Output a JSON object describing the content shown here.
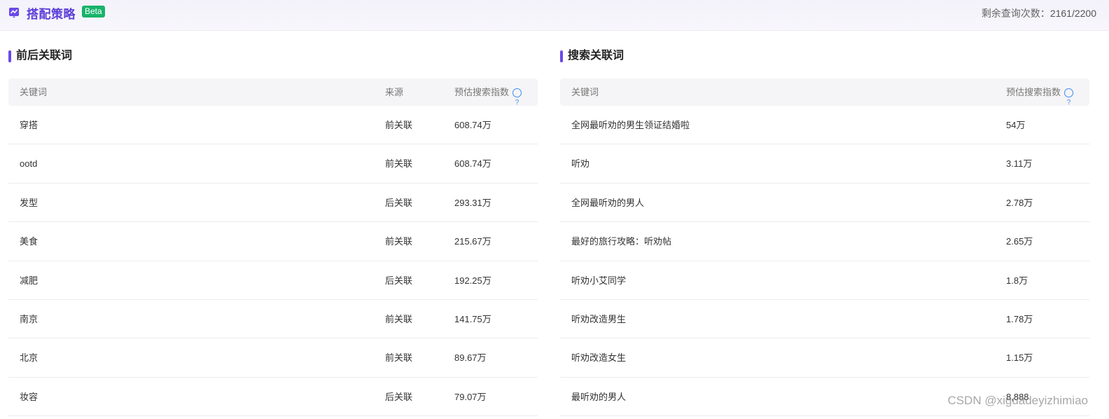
{
  "header": {
    "brand_title": "搭配策略",
    "beta_label": "Beta",
    "quota_label": "剩余查询次数：",
    "quota_value": "2161/2200"
  },
  "left_panel": {
    "title": "前后关联词",
    "columns": [
      "关键词",
      "来源",
      "预估搜索指数"
    ],
    "rows": [
      {
        "keyword": "穿搭",
        "source": "前关联",
        "index": "608.74万"
      },
      {
        "keyword": "ootd",
        "source": "前关联",
        "index": "608.74万"
      },
      {
        "keyword": "发型",
        "source": "后关联",
        "index": "293.31万"
      },
      {
        "keyword": "美食",
        "source": "前关联",
        "index": "215.67万"
      },
      {
        "keyword": "减肥",
        "source": "后关联",
        "index": "192.25万"
      },
      {
        "keyword": "南京",
        "source": "前关联",
        "index": "141.75万"
      },
      {
        "keyword": "北京",
        "source": "前关联",
        "index": "89.67万"
      },
      {
        "keyword": "妆容",
        "source": "后关联",
        "index": "79.07万"
      }
    ]
  },
  "right_panel": {
    "title": "搜索关联词",
    "columns": [
      "关键词",
      "预估搜索指数"
    ],
    "rows": [
      {
        "keyword": "全网最听劝的男生领证结婚啦",
        "index": "54万"
      },
      {
        "keyword": "听劝",
        "index": "3.11万"
      },
      {
        "keyword": "全网最听劝的男人",
        "index": "2.78万"
      },
      {
        "keyword": "最好的旅行攻略：听劝帖",
        "index": "2.65万"
      },
      {
        "keyword": "听劝小艾同学",
        "index": "1.8万"
      },
      {
        "keyword": "听劝改造男生",
        "index": "1.78万"
      },
      {
        "keyword": "听劝改造女生",
        "index": "1.15万"
      },
      {
        "keyword": "最听劝的男人",
        "index": "8,888"
      }
    ]
  },
  "watermark": "CSDN @xiguadeyizhimiao",
  "colors": {
    "accent": "#6a4ae8",
    "brand": "#5b3fd6",
    "beta": "#18b36a",
    "help": "#3d8bf5"
  }
}
